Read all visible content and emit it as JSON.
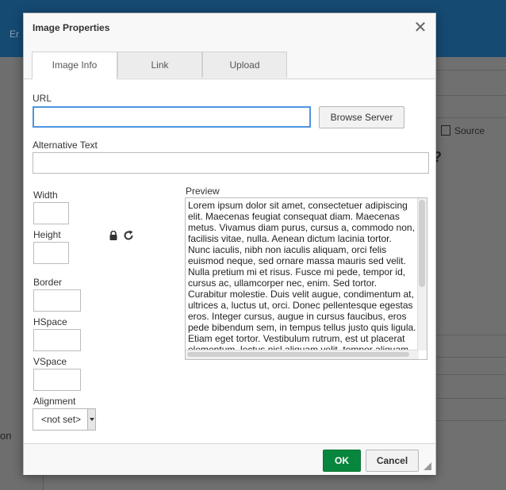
{
  "background": {
    "fragment_top": "Er",
    "source_label": "Source",
    "question_mark": "?",
    "fragment_left": "on"
  },
  "dialog": {
    "title": "Image Properties",
    "close_icon": "close-icon",
    "tabs": [
      {
        "label": "Image Info",
        "active": true
      },
      {
        "label": "Link",
        "active": false
      },
      {
        "label": "Upload",
        "active": false
      }
    ],
    "url": {
      "label": "URL",
      "value": "",
      "placeholder": ""
    },
    "browse_button": "Browse Server",
    "alt_text": {
      "label": "Alternative Text",
      "value": ""
    },
    "width": {
      "label": "Width",
      "value": ""
    },
    "height": {
      "label": "Height",
      "value": ""
    },
    "lock_icon": "lock-icon",
    "reset_icon": "reset-size-icon",
    "border": {
      "label": "Border",
      "value": ""
    },
    "hspace": {
      "label": "HSpace",
      "value": ""
    },
    "vspace": {
      "label": "VSpace",
      "value": ""
    },
    "alignment": {
      "label": "Alignment",
      "selected": "<not set>"
    },
    "preview": {
      "label": "Preview",
      "text": "Lorem ipsum dolor sit amet, consectetuer adipiscing elit. Maecenas feugiat consequat diam. Maecenas metus. Vivamus diam purus, cursus a, commodo non, facilisis vitae, nulla. Aenean dictum lacinia tortor. Nunc iaculis, nibh non iaculis aliquam, orci felis euismod neque, sed ornare massa mauris sed velit. Nulla pretium mi et risus. Fusce mi pede, tempor id, cursus ac, ullamcorper nec, enim. Sed tortor. Curabitur molestie. Duis velit augue, condimentum at, ultrices a, luctus ut, orci. Donec pellentesque egestas eros. Integer cursus, augue in cursus faucibus, eros pede bibendum sem, in tempus tellus justo quis ligula. Etiam eget tortor. Vestibulum rutrum, est ut placerat elementum, lectus nisl aliquam velit, tempor aliquam eros nunc nonummy metus."
    },
    "ok_button": "OK",
    "cancel_button": "Cancel",
    "colors": {
      "accent_focus": "#4b95e0",
      "ok_green": "#09863e",
      "header_bar": "#154a73"
    }
  }
}
